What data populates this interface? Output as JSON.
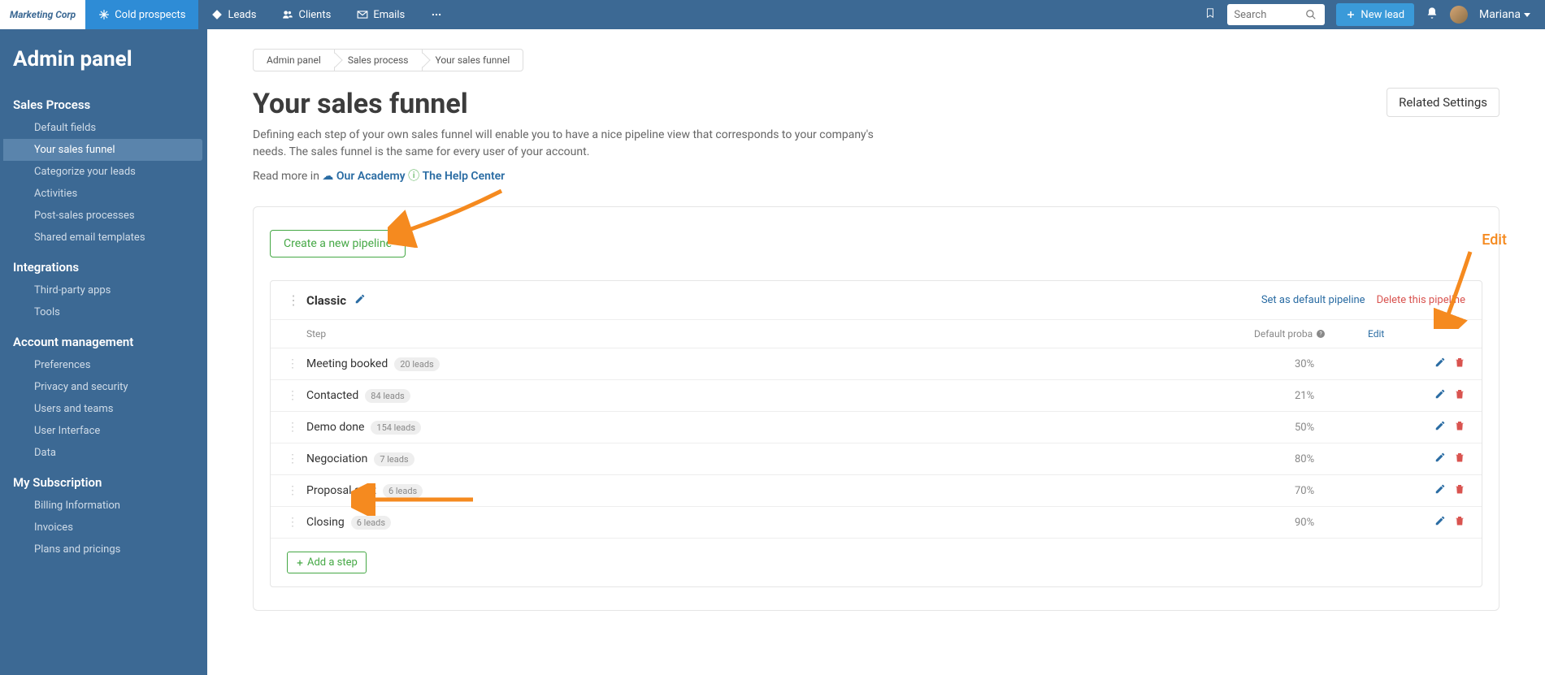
{
  "app": {
    "logo": "Marketing Corp",
    "user": "Mariana"
  },
  "topnav": {
    "items": [
      {
        "label": "Cold prospects"
      },
      {
        "label": "Leads"
      },
      {
        "label": "Clients"
      },
      {
        "label": "Emails"
      }
    ],
    "search_placeholder": "Search",
    "new_lead": "New lead"
  },
  "sidebar": {
    "title": "Admin panel",
    "sections": [
      {
        "heading": "Sales Process",
        "items": [
          {
            "label": "Default fields"
          },
          {
            "label": "Your sales funnel",
            "active": true
          },
          {
            "label": "Categorize your leads"
          },
          {
            "label": "Activities"
          },
          {
            "label": "Post-sales processes"
          },
          {
            "label": "Shared email templates"
          }
        ]
      },
      {
        "heading": "Integrations",
        "items": [
          {
            "label": "Third-party apps"
          },
          {
            "label": "Tools"
          }
        ]
      },
      {
        "heading": "Account management",
        "items": [
          {
            "label": "Preferences"
          },
          {
            "label": "Privacy and security"
          },
          {
            "label": "Users and teams"
          },
          {
            "label": "User Interface"
          },
          {
            "label": "Data"
          }
        ]
      },
      {
        "heading": "My Subscription",
        "items": [
          {
            "label": "Billing Information"
          },
          {
            "label": "Invoices"
          },
          {
            "label": "Plans and pricings"
          }
        ]
      }
    ]
  },
  "breadcrumb": {
    "items": [
      "Admin panel",
      "Sales process",
      "Your sales funnel"
    ]
  },
  "page": {
    "title": "Your sales funnel",
    "intro": "Defining each step of your own sales funnel will enable you to have a nice pipeline view that corresponds to your company's needs. The sales funnel is the same for every user of your account.",
    "read_more_prefix": "Read more in ",
    "academy_link": "Our Academy",
    "help_link": "The Help Center",
    "related_settings": "Related Settings"
  },
  "create_pipeline": "Create a new pipeline",
  "pipeline": {
    "name": "Classic",
    "set_default": "Set as default pipeline",
    "delete": "Delete this pipeline",
    "headers": {
      "step": "Step",
      "proba": "Default proba",
      "edit": "Edit"
    },
    "steps": [
      {
        "name": "Meeting booked",
        "leads": "20 leads",
        "proba": "30%"
      },
      {
        "name": "Contacted",
        "leads": "84 leads",
        "proba": "21%"
      },
      {
        "name": "Demo done",
        "leads": "154 leads",
        "proba": "50%"
      },
      {
        "name": "Negociation",
        "leads": "7 leads",
        "proba": "80%"
      },
      {
        "name": "Proposal sent",
        "leads": "6 leads",
        "proba": "70%"
      },
      {
        "name": "Closing",
        "leads": "6 leads",
        "proba": "90%"
      }
    ],
    "add_step": "Add a step"
  },
  "callouts": {
    "edit": "Edit"
  }
}
